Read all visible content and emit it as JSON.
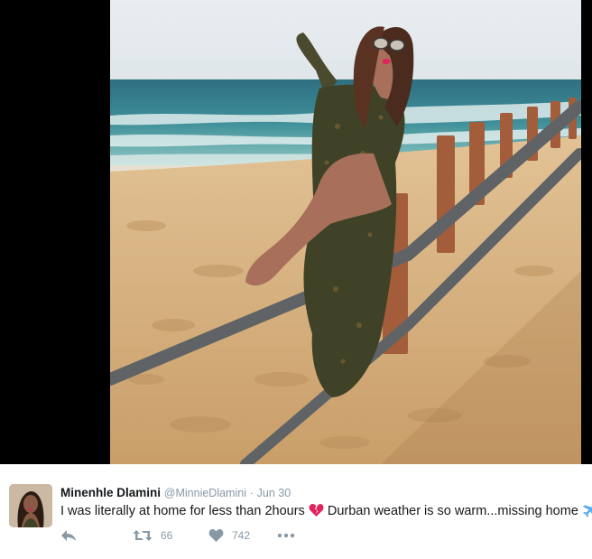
{
  "tweet": {
    "name": "Minenhle Dlamini",
    "handle": "@MinnieDlamini",
    "separator": "·",
    "time": "Jun 30",
    "text_before_emoji": "I was literally at home for less than 2hours",
    "text_after_emoji": "Durban weather is so warm...missing home",
    "emojis": [
      "broken-heart",
      "airplane"
    ]
  },
  "actions": {
    "reply_icon": "reply-icon",
    "retweet_icon": "retweet-icon",
    "retweet_count": "66",
    "like_icon": "heart-icon",
    "like_count": "742",
    "more_icon": "more-dots-icon"
  },
  "colors": {
    "media_background": "#000000",
    "text": "#14171a",
    "muted": "#8899a6",
    "heart_emoji": "#e0245e",
    "plane_emoji": "#5dadec"
  }
}
